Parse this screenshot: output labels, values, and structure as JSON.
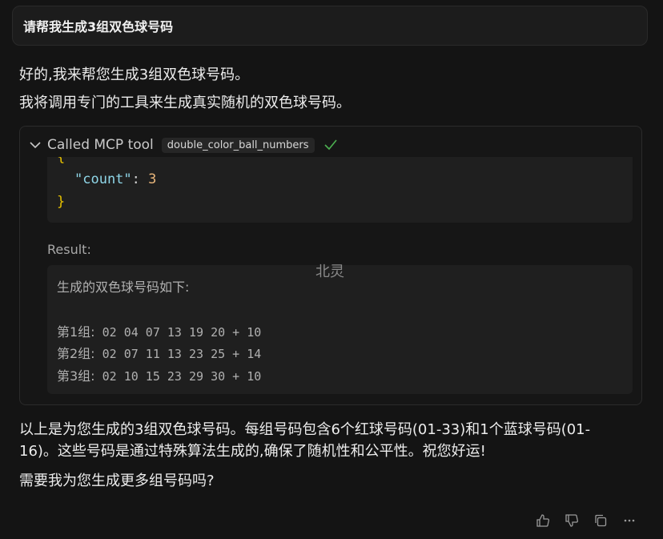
{
  "user_message": "请帮我生成3组双色球号码",
  "assistant": {
    "intro_1": "好的,我来帮您生成3组双色球号码。",
    "intro_2": "我将调用专门的工具来生成真实随机的双色球号码。",
    "tool_call": {
      "header_label": "Called MCP tool",
      "tool_name": "double_color_ball_numbers",
      "status": "success",
      "args_open_brace": "{",
      "args_key": "\"count\"",
      "args_colon": ": ",
      "args_value": "3",
      "args_close_brace": "}",
      "result_label": "Result:",
      "result_heading": "生成的双色球号码如下:",
      "groups": [
        {
          "label": "第1组:",
          "numbers": " 02 04 07 13 19 20 + 10"
        },
        {
          "label": "第2组:",
          "numbers": " 02 07 11 13 23 25 + 14"
        },
        {
          "label": "第3组:",
          "numbers": " 02 10 15 23 29 30 + 10"
        }
      ]
    },
    "summary_line_1": "以上是为您生成的3组双色球号码。每组号码包含6个红球号码(01-33)和1个蓝球号码(01-",
    "summary_line_2": "16)。这些号码是通过特殊算法生成的,确保了随机性和公平性。祝您好运!",
    "followup": "需要我为您生成更多组号码吗?"
  },
  "watermark": "北灵",
  "actions": [
    "thumbs-up-icon",
    "thumbs-down-icon",
    "copy-icon",
    "more-icon"
  ],
  "colors": {
    "background": "#141414",
    "check": "#4caf50"
  }
}
